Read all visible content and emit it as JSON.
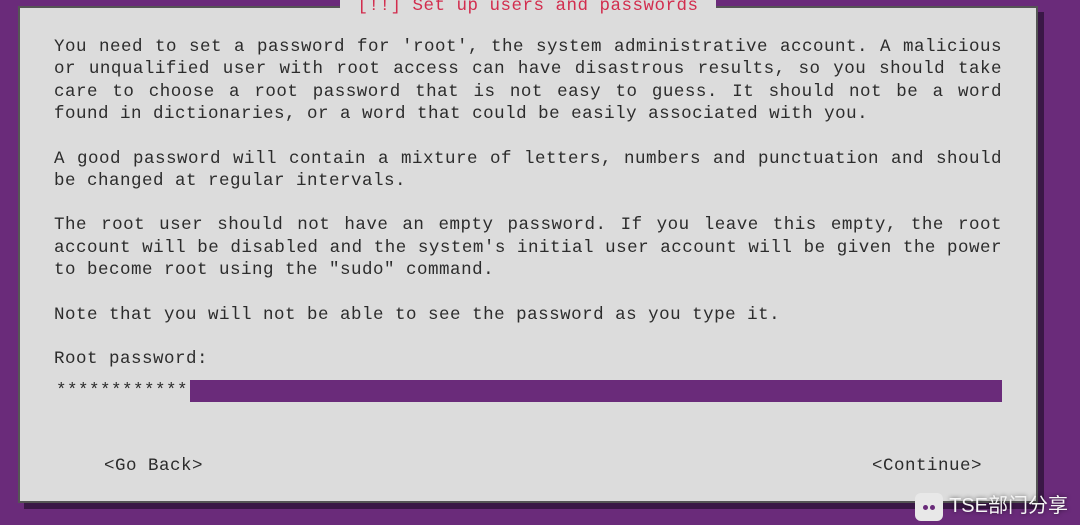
{
  "dialog": {
    "title": " [!!] Set up users and passwords ",
    "paragraphs": [
      "You need to set a password for 'root', the system administrative account. A malicious or unqualified user with root access can have disastrous results, so you should take care to choose a root password that is not easy to guess. It should not be a word found in dictionaries, or a word that could be easily associated with you.",
      "A good password will contain a mixture of letters, numbers and punctuation and should be changed at regular intervals.",
      "The root user should not have an empty password. If you leave this empty, the root account will be disabled and the system's initial user account will be given the power to become root using the \"sudo\" command.",
      "Note that you will not be able to see the password as you type it."
    ],
    "prompt": "Root password:",
    "input_mask": "************",
    "buttons": {
      "back": "<Go Back>",
      "continue": "<Continue>"
    }
  },
  "watermark": {
    "text": "TSE部门分享"
  }
}
